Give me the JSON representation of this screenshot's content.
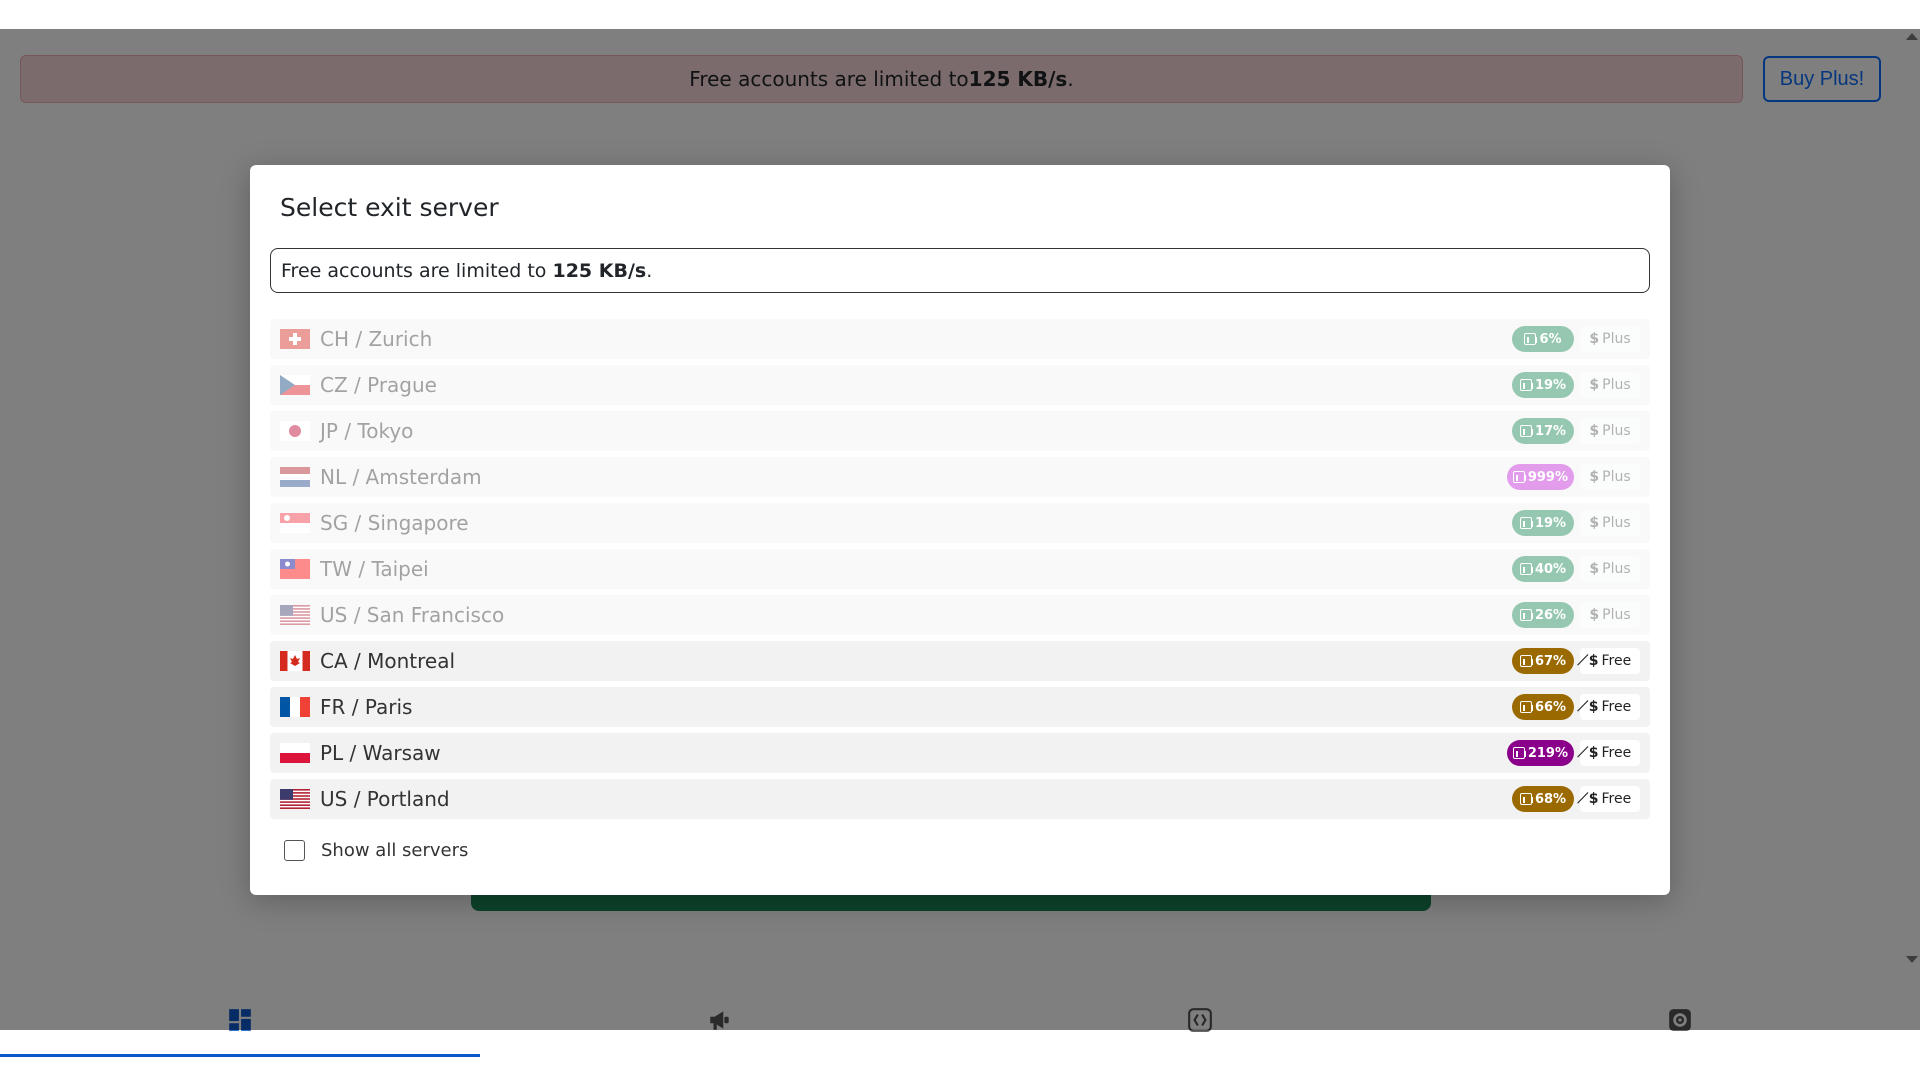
{
  "banner": {
    "text_prefix": "Free accounts are limited to ",
    "text_bold": "125 KB/s",
    "text_suffix": "."
  },
  "buy_button": "Buy Plus!",
  "modal": {
    "title": "Select exit server",
    "alert": {
      "text_prefix": "Free accounts are limited to ",
      "text_bold": "125 KB/s",
      "text_suffix": "."
    },
    "servers": [
      {
        "name": "CH / Zurich",
        "load": "6%",
        "tier": "Plus",
        "flag": "CH"
      },
      {
        "name": "CZ / Prague",
        "load": "19%",
        "tier": "Plus",
        "flag": "CZ"
      },
      {
        "name": "JP / Tokyo",
        "load": "17%",
        "tier": "Plus",
        "flag": "JP"
      },
      {
        "name": "NL / Amsterdam",
        "load": "999%",
        "tier": "Plus",
        "flag": "NL"
      },
      {
        "name": "SG / Singapore",
        "load": "19%",
        "tier": "Plus",
        "flag": "SG"
      },
      {
        "name": "TW / Taipei",
        "load": "40%",
        "tier": "Plus",
        "flag": "TW"
      },
      {
        "name": "US / San Francisco",
        "load": "26%",
        "tier": "Plus",
        "flag": "US"
      },
      {
        "name": "CA / Montreal",
        "load": "67%",
        "tier": "Free",
        "flag": "CA"
      },
      {
        "name": "FR / Paris",
        "load": "66%",
        "tier": "Free",
        "flag": "FR"
      },
      {
        "name": "PL / Warsaw",
        "load": "219%",
        "tier": "Free",
        "flag": "PL"
      },
      {
        "name": "US / Portland",
        "load": "68%",
        "tier": "Free",
        "flag": "US"
      }
    ],
    "show_all_label": "Show all servers",
    "show_all_checked": false
  },
  "nav": {
    "tabs": [
      {
        "icon": "dashboard-icon",
        "active": true
      },
      {
        "icon": "megaphone-icon",
        "active": false
      },
      {
        "icon": "code-icon",
        "active": false
      },
      {
        "icon": "settings-icon",
        "active": false
      }
    ]
  },
  "colors": {
    "load_low": "#198754",
    "load_mid": "#9a6a00",
    "load_over": "#c026d3",
    "load_over_free": "#8b008b",
    "banner_bg": "#f8d7da",
    "accent": "#0d6efd"
  }
}
